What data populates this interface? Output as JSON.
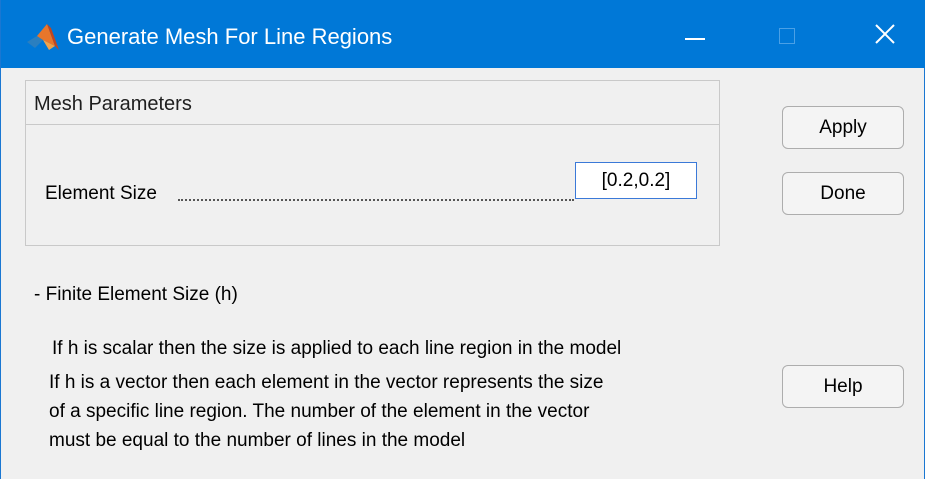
{
  "window": {
    "title": "Generate Mesh For Line Regions",
    "icon": "matlab-logo-icon",
    "controls": [
      "minimize-icon",
      "maximize-icon",
      "close-icon"
    ],
    "accent_color": "#0078d7"
  },
  "panel": {
    "title": "Mesh Parameters",
    "element_size_label": "Element Size",
    "element_size_value": "[0.2,0.2]"
  },
  "buttons": {
    "apply": "Apply",
    "done": "Done",
    "help": "Help"
  },
  "help": {
    "heading": "- Finite Element Size (h)",
    "lines": [
      "If h is scalar then the size is applied  to each line region in the model",
      "If h is a vector then each element in the vector represents the size",
      "of a specific line region. The number of the element in the vector",
      "must be equal to the number of lines in the model"
    ]
  }
}
